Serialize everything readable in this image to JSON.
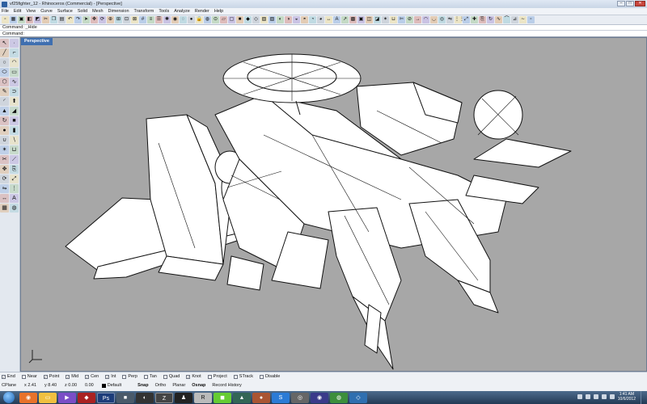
{
  "window": {
    "title": "vf25fighter_12 - Rhinoceros (Commercial) - [Perspective]"
  },
  "menu": [
    "File",
    "Edit",
    "View",
    "Curve",
    "Surface",
    "Solid",
    "Mesh",
    "Dimension",
    "Transform",
    "Tools",
    "Analyze",
    "Render",
    "Help"
  ],
  "toolbar_icons": [
    "new-file",
    "open-file",
    "save",
    "print",
    "import",
    "cut",
    "copy",
    "paste",
    "undo",
    "redo",
    "select",
    "pan",
    "rotate",
    "zoom",
    "zoom-window",
    "zoom-extents",
    "zoom-selected",
    "grid",
    "layers",
    "properties",
    "lights",
    "render",
    "hide",
    "show",
    "lock",
    "unlock",
    "osnap",
    "planar",
    "wireframe",
    "shaded",
    "rendered",
    "ghosted",
    "xray",
    "cplane",
    "analyze",
    "curvature",
    "zebra",
    "draft",
    "environment",
    "texture",
    "dimension",
    "text",
    "leader",
    "hatch",
    "block",
    "group",
    "ungroup",
    "explode",
    "join",
    "trim",
    "split",
    "extend",
    "fillet",
    "chamfer",
    "offset",
    "mirror",
    "array",
    "scale",
    "move",
    "copy-obj",
    "orient",
    "flow",
    "twist",
    "bend",
    "taper",
    "smooth"
  ],
  "command": {
    "history": "Command: _Hide",
    "prompt": "Command:"
  },
  "viewport": {
    "label": "Perspective"
  },
  "osnaps": [
    {
      "label": "End",
      "checked": true
    },
    {
      "label": "Near",
      "checked": false
    },
    {
      "label": "Point",
      "checked": true
    },
    {
      "label": "Mid",
      "checked": true
    },
    {
      "label": "Cen",
      "checked": true
    },
    {
      "label": "Int",
      "checked": true
    },
    {
      "label": "Perp",
      "checked": false
    },
    {
      "label": "Tan",
      "checked": false
    },
    {
      "label": "Quad",
      "checked": false
    },
    {
      "label": "Knot",
      "checked": true
    },
    {
      "label": "Project",
      "checked": false
    },
    {
      "label": "STrack",
      "checked": false
    },
    {
      "label": "Disable",
      "checked": false
    }
  ],
  "status": {
    "cplane": "CPlane",
    "x": "x 2.41",
    "y": "y 8.40",
    "z": "z 0.00",
    "extra": "0.00",
    "layer": "Default",
    "panes": [
      {
        "label": "Snap",
        "on": true
      },
      {
        "label": "Ortho",
        "on": false
      },
      {
        "label": "Planar",
        "on": false
      },
      {
        "label": "Osnap",
        "on": true
      },
      {
        "label": "Record History",
        "on": false
      }
    ]
  },
  "taskbar": {
    "clock_time": "1:41 AM",
    "clock_date": "10/6/2012"
  },
  "colors": {
    "viewport_bg": "#a7a7a7",
    "viewport_tab": "#3f6fb0",
    "model_fill": "#ffffff",
    "model_edge": "#111111"
  }
}
